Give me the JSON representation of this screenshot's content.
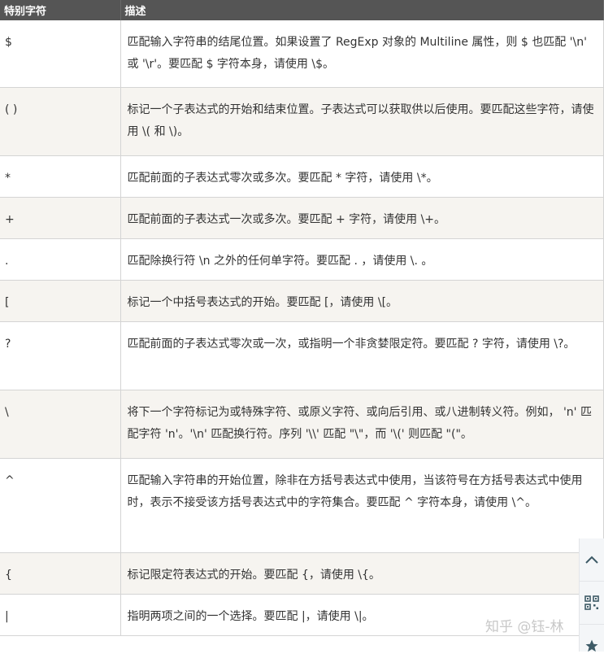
{
  "table": {
    "headers": {
      "symbol": "特别字符",
      "description": "描述"
    },
    "rows": [
      {
        "symbol": "$",
        "description": "匹配输入字符串的结尾位置。如果设置了 RegExp 对象的 Multiline 属性，则 $ 也匹配 '\\n' 或 '\\r'。要匹配 $ 字符本身，请使用 \\$。"
      },
      {
        "symbol": "( )",
        "description": "标记一个子表达式的开始和结束位置。子表达式可以获取供以后使用。要匹配这些字符，请使用 \\( 和 \\)。"
      },
      {
        "symbol": "*",
        "description": "匹配前面的子表达式零次或多次。要匹配 * 字符，请使用 \\*。"
      },
      {
        "symbol": "+",
        "description": "匹配前面的子表达式一次或多次。要匹配 + 字符，请使用 \\+。"
      },
      {
        "symbol": ".",
        "description": "匹配除换行符 \\n 之外的任何单字符。要匹配 . ，请使用 \\. 。"
      },
      {
        "symbol": "[",
        "description": "标记一个中括号表达式的开始。要匹配 [，请使用 \\[。"
      },
      {
        "symbol": "?",
        "description": "匹配前面的子表达式零次或一次，或指明一个非贪婪限定符。要匹配 ? 字符，请使用 \\?。"
      },
      {
        "symbol": "\\",
        "description": "将下一个字符标记为或特殊字符、或原义字符、或向后引用、或八进制转义符。例如， 'n' 匹配字符 'n'。'\\n' 匹配换行符。序列 '\\\\' 匹配 \"\\\"，而 '\\(' 则匹配 \"(\"。"
      },
      {
        "symbol": "^",
        "description": "匹配输入字符串的开始位置，除非在方括号表达式中使用，当该符号在方括号表达式中使用时，表示不接受该方括号表达式中的字符集合。要匹配 ^ 字符本身，请使用 \\^。"
      },
      {
        "symbol": "{",
        "description": "标记限定符表达式的开始。要匹配 {，请使用 \\{。"
      },
      {
        "symbol": "|",
        "description": "指明两项之间的一个选择。要匹配 |，请使用 \\|。"
      }
    ]
  },
  "watermark": "知乎 @钰-林",
  "side_actions": {
    "icons": [
      "chevron-up-icon",
      "qr-code-icon",
      "star-icon"
    ]
  },
  "colors": {
    "header_bg": "#555555",
    "header_text": "#ffffff",
    "row_alt": "#f6f4f0",
    "border": "#d4d4d4"
  }
}
